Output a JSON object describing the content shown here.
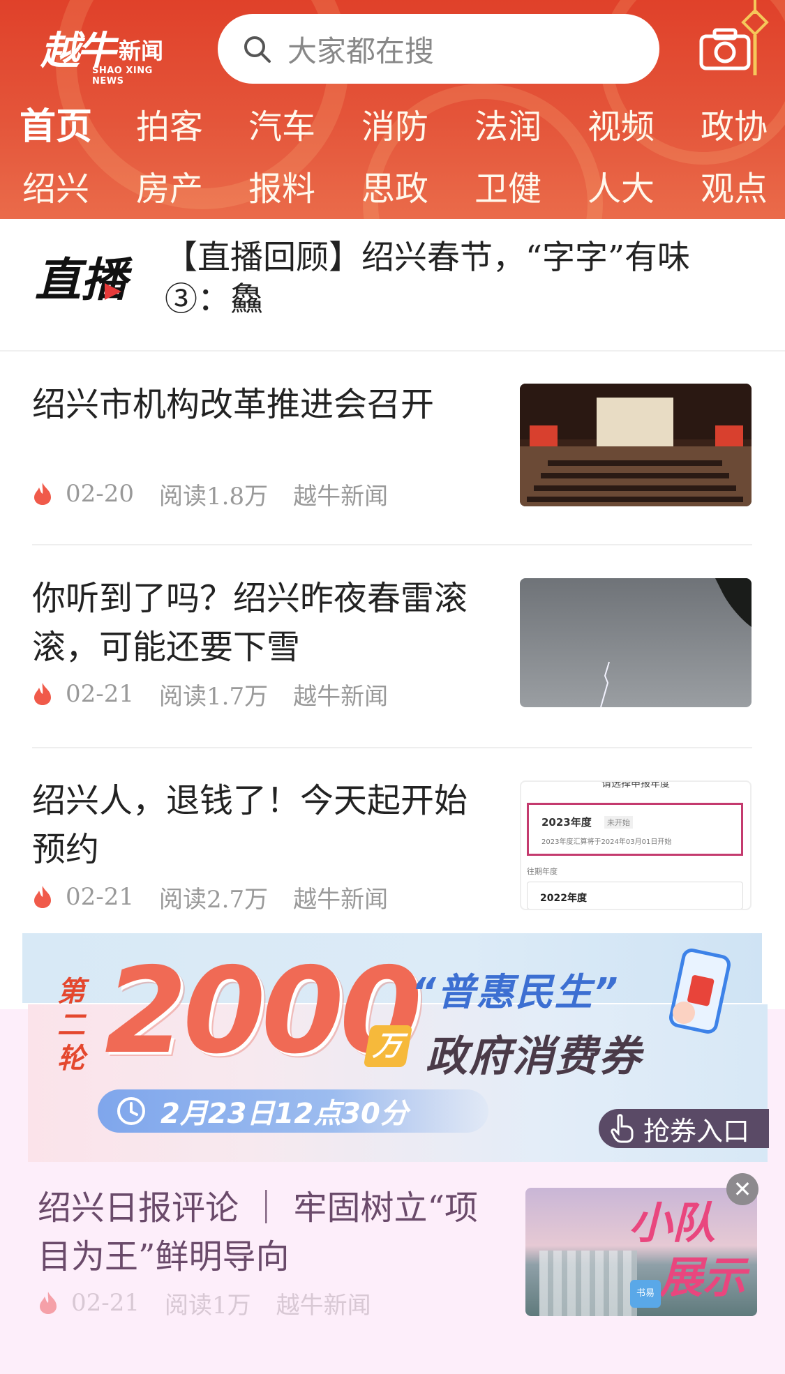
{
  "header": {
    "logo_text": "越牛",
    "logo_sub": "新闻",
    "logo_en": "SHAO XING NEWS",
    "search_placeholder": "大家都在搜"
  },
  "nav": {
    "row1": [
      "首页",
      "拍客",
      "汽车",
      "消防",
      "法润",
      "视频",
      "政协"
    ],
    "row2": [
      "绍兴",
      "房产",
      "报料",
      "思政",
      "卫健",
      "人大",
      "观点"
    ],
    "active": "首页"
  },
  "live": {
    "logo_text": "直播",
    "headline": "【直播回顾】绍兴春节，“字字”有味③：鱻"
  },
  "articles": [
    {
      "title": "绍兴市机构改革推进会召开",
      "date": "02-20",
      "reads": "阅读1.8万",
      "source": "越牛新闻"
    },
    {
      "title": "你听到了吗？绍兴昨夜春雷滚滚，可能还要下雪",
      "date": "02-21",
      "reads": "阅读1.7万",
      "source": "越牛新闻"
    },
    {
      "title": "绍兴人，退钱了！今天起开始预约",
      "date": "02-21",
      "reads": "阅读2.7万",
      "source": "越牛新闻"
    }
  ],
  "thumb3": {
    "header_text": "请选择申报年度",
    "year_current": "2023年度",
    "status": "未开始",
    "note": "2023年度汇算将于2024年03月01日开始",
    "past_label": "往期年度",
    "year_past": "2022年度"
  },
  "banner": {
    "round_label": "第二轮",
    "amount": "2000",
    "unit": "万",
    "slogan": "“普惠民生”",
    "title": "政府消费券",
    "datetime": "2月23日12点30分",
    "cta": "抢券入口"
  },
  "overlay_article": {
    "title": "绍兴日报评论 ｜ 牢固树立“项目为王”鲜明导向",
    "date": "02-21",
    "reads": "阅读1万",
    "source": "越牛新闻",
    "thumb_text_1": "小队",
    "thumb_text_2": "展示",
    "thumb_badge": "书易"
  },
  "colors": {
    "header_red": "#e0412a",
    "fire": "#f05a4a",
    "banner_red": "#f06a55",
    "banner_blue": "#3c6fd2"
  }
}
